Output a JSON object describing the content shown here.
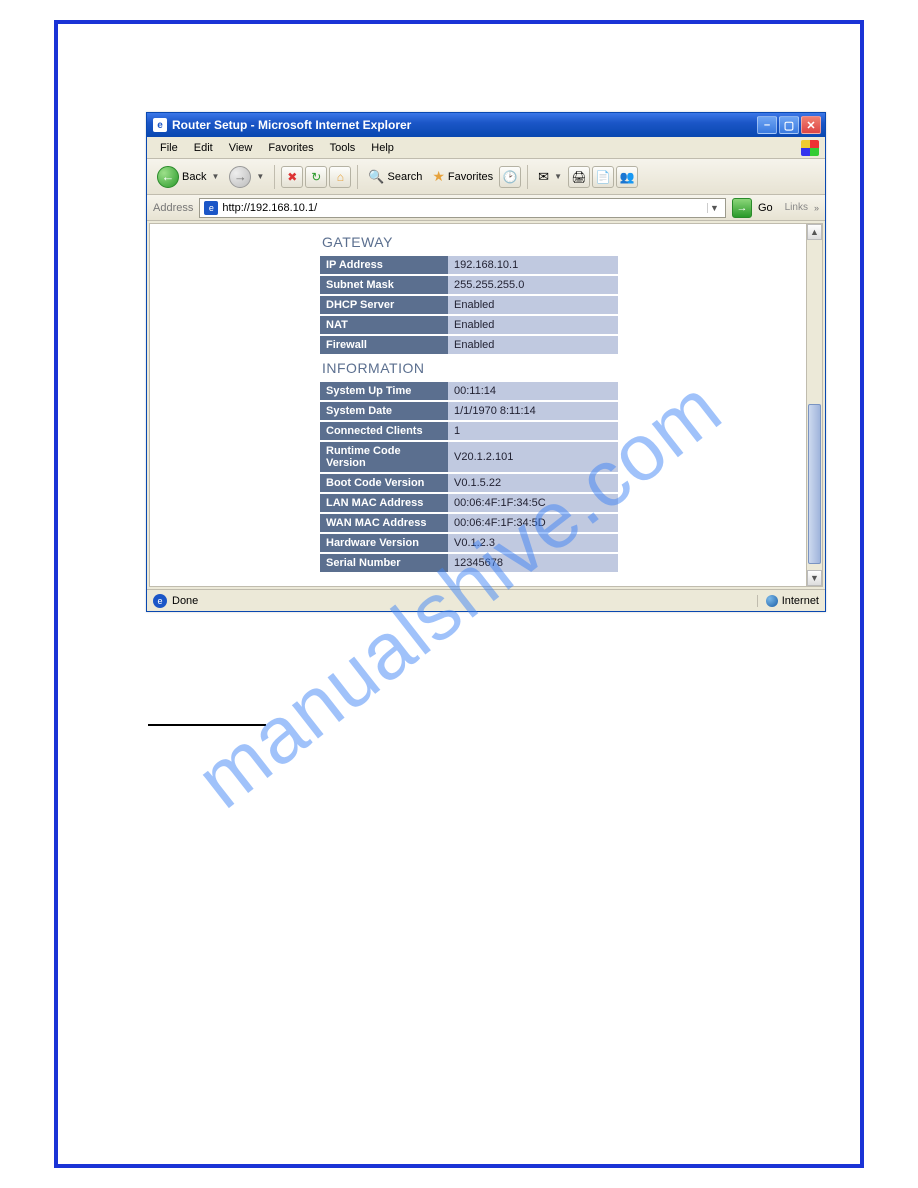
{
  "window": {
    "title": "Router Setup - Microsoft Internet Explorer"
  },
  "menu": {
    "file": "File",
    "edit": "Edit",
    "view": "View",
    "favorites": "Favorites",
    "tools": "Tools",
    "help": "Help"
  },
  "toolbar": {
    "back": "Back",
    "search": "Search",
    "favorites": "Favorites"
  },
  "address": {
    "label": "Address",
    "url": "http://192.168.10.1/",
    "go": "Go",
    "links": "Links"
  },
  "sections": {
    "gateway": {
      "title": "GATEWAY",
      "rows": [
        {
          "k": "IP Address",
          "v": "192.168.10.1"
        },
        {
          "k": "Subnet Mask",
          "v": "255.255.255.0"
        },
        {
          "k": "DHCP Server",
          "v": "Enabled"
        },
        {
          "k": "NAT",
          "v": "Enabled"
        },
        {
          "k": "Firewall",
          "v": "Enabled"
        }
      ]
    },
    "information": {
      "title": "INFORMATION",
      "rows": [
        {
          "k": "System Up Time",
          "v": "00:11:14"
        },
        {
          "k": "System Date",
          "v": "1/1/1970 8:11:14"
        },
        {
          "k": "Connected Clients",
          "v": "1"
        },
        {
          "k": "Runtime Code Version",
          "v": "V20.1.2.101"
        },
        {
          "k": "Boot Code Version",
          "v": "V0.1.5.22"
        },
        {
          "k": "LAN MAC Address",
          "v": "00:06:4F:1F:34:5C"
        },
        {
          "k": "WAN MAC Address",
          "v": "00:06:4F:1F:34:5D"
        },
        {
          "k": "Hardware Version",
          "v": "V0.1.2.3"
        },
        {
          "k": "Serial Number",
          "v": "12345678"
        }
      ]
    }
  },
  "status": {
    "text": "Done",
    "zone": "Internet"
  },
  "watermark": "manualshive.com"
}
